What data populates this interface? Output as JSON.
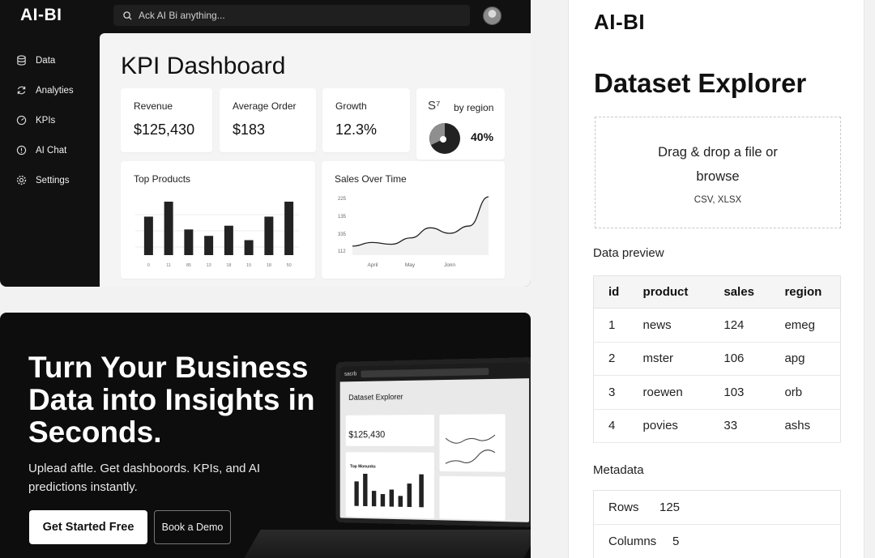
{
  "app": {
    "brand": "AI-BI",
    "search_placeholder": "Ack AI Bi anything...",
    "sidebar": [
      {
        "label": "Data",
        "icon": "database-icon"
      },
      {
        "label": "Analyties",
        "icon": "refresh-icon"
      },
      {
        "label": "KPIs",
        "icon": "gauge-icon"
      },
      {
        "label": "AI Chat",
        "icon": "chat-icon"
      },
      {
        "label": "Settings",
        "icon": "gear-icon"
      }
    ],
    "title": "KPI Dashboard",
    "kpis": [
      {
        "label": "Revenue",
        "value": "$125,430"
      },
      {
        "label": "Average Order",
        "value": "$183"
      },
      {
        "label": "Growth",
        "value": "12.3%"
      }
    ],
    "region": {
      "symbol": "S⁷",
      "label": "by region",
      "value": "40%"
    }
  },
  "chart_data": [
    {
      "type": "bar",
      "title": "Top Products",
      "categories": [
        "0",
        "11",
        "85",
        "13",
        "18",
        "15",
        "18",
        "50"
      ],
      "values": [
        72,
        100,
        48,
        36,
        55,
        28,
        72,
        100
      ],
      "color": "#222222"
    },
    {
      "type": "area",
      "title": "Sales Over Time",
      "x_ticks": [
        "April",
        "May",
        "Jonn"
      ],
      "y_ticks": [
        "225",
        "135",
        "335",
        "112"
      ],
      "values": [
        2,
        10,
        6,
        20,
        42,
        30,
        46,
        110
      ],
      "color": "#222222"
    }
  ],
  "hero": {
    "headline": "Turn Your Business Data into Insights in Seconds.",
    "subtext": "Uplead aftle. Get dashboords. KPIs, and AI predictions instantly.",
    "primary_cta": "Get Started Free",
    "secondary_cta": "Book a Demo",
    "mockup": {
      "brand": "sacrb",
      "title": "Dataset Explorer",
      "value": "$125,430",
      "section": "Top Monunks"
    }
  },
  "explorer": {
    "brand": "AI-BI",
    "title": "Dataset Explorer",
    "dropzone_text": "Drag & drop a file or browse",
    "dropzone_formats": "CSV, XLSX",
    "preview_heading": "Data preview",
    "columns": [
      "id",
      "product",
      "sales",
      "region"
    ],
    "rows": [
      [
        "1",
        "news",
        "124",
        "emeg"
      ],
      [
        "2",
        "mster",
        "106",
        "apg"
      ],
      [
        "3",
        "roewen",
        "103",
        "orb"
      ],
      [
        "4",
        "povies",
        "33",
        "ashs"
      ]
    ],
    "metadata_heading": "Metadata",
    "metadata": [
      {
        "key": "Rows",
        "value": "125"
      },
      {
        "key": "Columns",
        "value": "5"
      }
    ]
  }
}
